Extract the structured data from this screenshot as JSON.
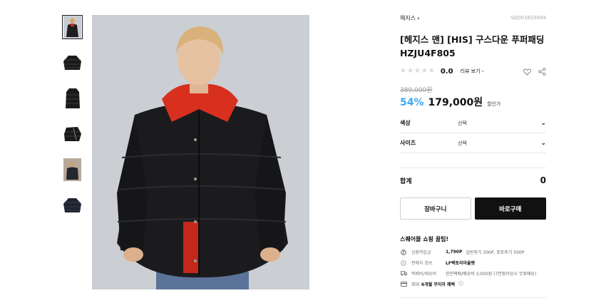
{
  "thumbnails": [
    {
      "name": "thumb-front-model",
      "active": true
    },
    {
      "name": "thumb-front-flat"
    },
    {
      "name": "thumb-back-flat"
    },
    {
      "name": "thumb-side-flat"
    },
    {
      "name": "thumb-model-2"
    },
    {
      "name": "thumb-model-3"
    }
  ],
  "product": {
    "brand": "헤지스",
    "code": "SQ001603684",
    "title": "[헤지스 맨] [HIS] 구스다운 푸퍼패딩 HZJU4F805",
    "rating": "0.0",
    "review_link": "리뷰 보기",
    "original_price": "389,000원",
    "discount": "54%",
    "price": "179,000원",
    "price_note": "할인가"
  },
  "options": [
    {
      "label": "색상",
      "value": "선택"
    },
    {
      "label": "사이즈",
      "value": "선택"
    }
  ],
  "total": {
    "label": "합계",
    "value": "0"
  },
  "buttons": {
    "cart": "장바구니",
    "buy": "바로구매"
  },
  "tips": {
    "title": "스퀘어몰 쇼핑 꿀팁!",
    "items": [
      {
        "icon": "points-icon",
        "label": "상품적립금",
        "bold": "1,790P",
        "text": "일반후기 300P, 포토후기 500P"
      },
      {
        "icon": "info-icon",
        "label": "판매자 정보",
        "bold": "LF렉토리아울렛",
        "text": ""
      },
      {
        "icon": "truck-icon",
        "label": "택배비/배송비",
        "bold": "",
        "text": "한진택배/배송비 3,000원 (7만원이상시 무료배송)"
      },
      {
        "icon": "card-icon",
        "label": "",
        "bold": "최대 6개월 무이자 혜택",
        "text": ""
      }
    ]
  },
  "colors": {
    "accent": "#3fa9f5",
    "buy_button": "#111111"
  }
}
